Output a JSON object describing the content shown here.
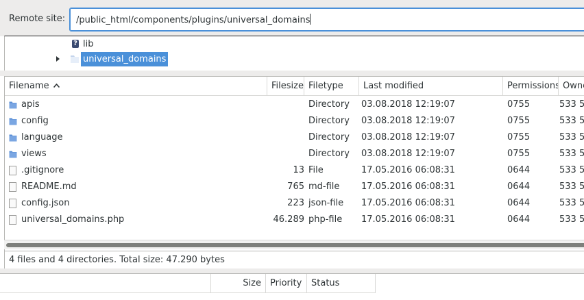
{
  "remote_site": {
    "label": "Remote site:",
    "path": "/public_html/components/plugins/universal_domains"
  },
  "tree": {
    "items": [
      {
        "label": "lib",
        "icon": "question-icon"
      },
      {
        "label": "universal_domains",
        "icon": "folder-icon",
        "selected": true
      }
    ]
  },
  "filelist": {
    "columns": {
      "filename": "Filename",
      "filesize": "Filesize",
      "filetype": "Filetype",
      "last_modified": "Last modified",
      "permissions": "Permissions",
      "owner": "Owne"
    },
    "rows": [
      {
        "name": "apis",
        "size": "",
        "type": "Directory",
        "modified": "03.08.2018 12:19:07",
        "perms": "0755",
        "owner": "533 5",
        "icon": "folder-icon"
      },
      {
        "name": "config",
        "size": "",
        "type": "Directory",
        "modified": "03.08.2018 12:19:07",
        "perms": "0755",
        "owner": "533 5",
        "icon": "folder-icon"
      },
      {
        "name": "language",
        "size": "",
        "type": "Directory",
        "modified": "03.08.2018 12:19:07",
        "perms": "0755",
        "owner": "533 5",
        "icon": "folder-icon"
      },
      {
        "name": "views",
        "size": "",
        "type": "Directory",
        "modified": "03.08.2018 12:19:07",
        "perms": "0755",
        "owner": "533 5",
        "icon": "folder-icon"
      },
      {
        "name": ".gitignore",
        "size": "13",
        "type": "File",
        "modified": "17.05.2016 06:08:31",
        "perms": "0644",
        "owner": "533 5",
        "icon": "file-icon"
      },
      {
        "name": "README.md",
        "size": "765",
        "type": "md-file",
        "modified": "17.05.2016 06:08:31",
        "perms": "0644",
        "owner": "533 5",
        "icon": "file-icon"
      },
      {
        "name": "config.json",
        "size": "223",
        "type": "json-file",
        "modified": "17.05.2016 06:08:31",
        "perms": "0644",
        "owner": "533 5",
        "icon": "file-icon"
      },
      {
        "name": "universal_domains.php",
        "size": "46.289",
        "type": "php-file",
        "modified": "17.05.2016 06:08:31",
        "perms": "0644",
        "owner": "533 5",
        "icon": "file-icon"
      }
    ],
    "status": "4 files and 4 directories. Total size: 47.290 bytes"
  },
  "queue": {
    "columns": {
      "size": "Size",
      "priority": "Priority",
      "status": "Status"
    }
  },
  "colors": {
    "selection": "#4a90d9",
    "folder": "#5a8fd6",
    "background": "#edeceb"
  }
}
